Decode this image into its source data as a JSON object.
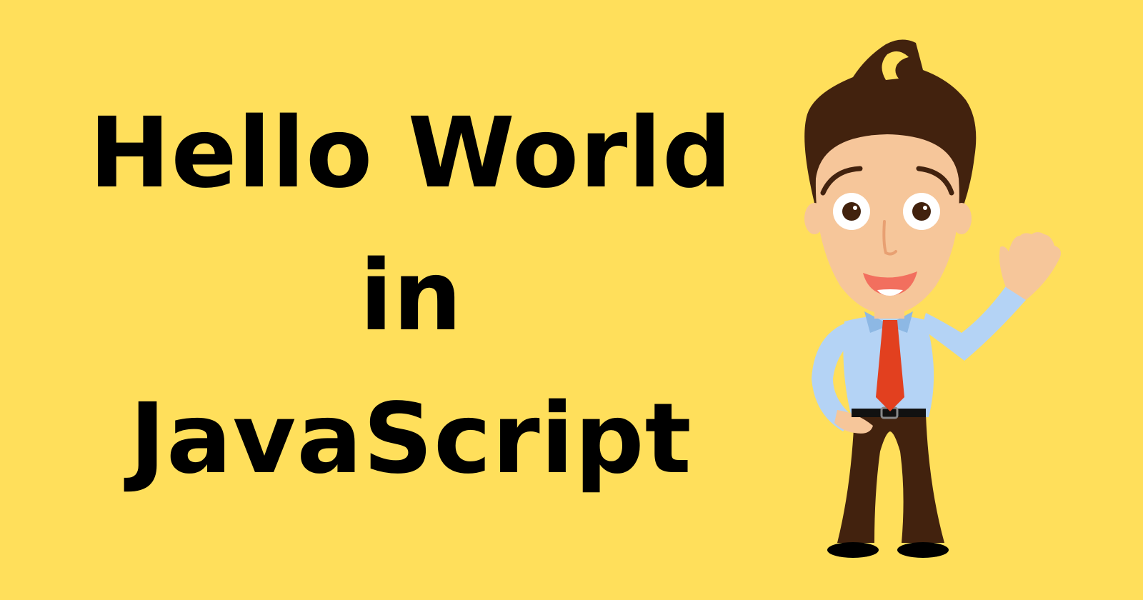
{
  "headline": {
    "line1": "Hello World",
    "line2": "in",
    "line3": "JavaScript"
  },
  "illustration": {
    "subject": "waving-cartoon-man"
  },
  "colors": {
    "background": "#FFDF5B",
    "text": "#000000",
    "hair": "#42220E",
    "skin": "#F6C69A",
    "shirt": "#B4D3F5",
    "tie": "#E2401F",
    "trousers": "#42220E"
  }
}
